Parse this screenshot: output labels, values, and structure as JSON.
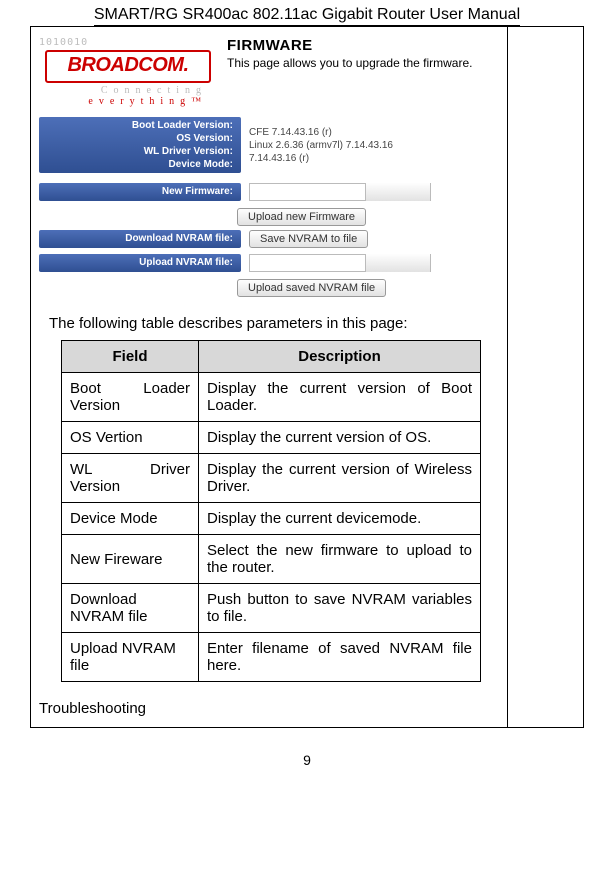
{
  "doc_title": "SMART/RG SR400ac 802.11ac Gigabit Router User Manual",
  "page_number": "9",
  "hero": {
    "binary_strip": "1010010",
    "logo_text": "BROADCOM.",
    "logo_tag_prefix_grey": "Connecting",
    "logo_tag_main": "everything",
    "fw_heading": "FIRMWARE",
    "fw_sub": "This page allows you to upgrade the firmware."
  },
  "version_block": {
    "labels": "Boot Loader Version:\nOS Version:\nWL Driver Version:\nDevice Mode:",
    "values": "CFE 7.14.43.16 (r)\nLinux 2.6.36 (armv7l) 7.14.43.16\n7.14.43.16 (r)"
  },
  "rows": {
    "new_fw_label": "New Firmware:",
    "btn_upload_new": "Upload new Firmware",
    "dl_nvram_label": "Download NVRAM file:",
    "btn_save_nvram": "Save NVRAM to file",
    "ul_nvram_label": "Upload NVRAM file:",
    "btn_upload_saved": "Upload saved NVRAM file"
  },
  "intro_line": "The following table describes parameters in this page:",
  "table": {
    "h_field": "Field",
    "h_desc": "Description",
    "rows": [
      {
        "field": "Boot Loader Version",
        "desc": "Display the current version of Boot Loader."
      },
      {
        "field": "OS Vertion",
        "desc": "Display the current version of OS."
      },
      {
        "field": "WL Driver Version",
        "desc": "Display the current version of Wireless Driver."
      },
      {
        "field": "Device Mode",
        "desc": "Display the current devicemode."
      },
      {
        "field": "New Fireware",
        "desc": "Select the new firmware to upload to the router."
      },
      {
        "field": "Download NVRAM file",
        "desc": "Push button to save NVRAM variables to file."
      },
      {
        "field": "Upload NVRAM file",
        "desc": "Enter filename of saved NVRAM file here."
      }
    ]
  },
  "section_heading": "Troubleshooting"
}
